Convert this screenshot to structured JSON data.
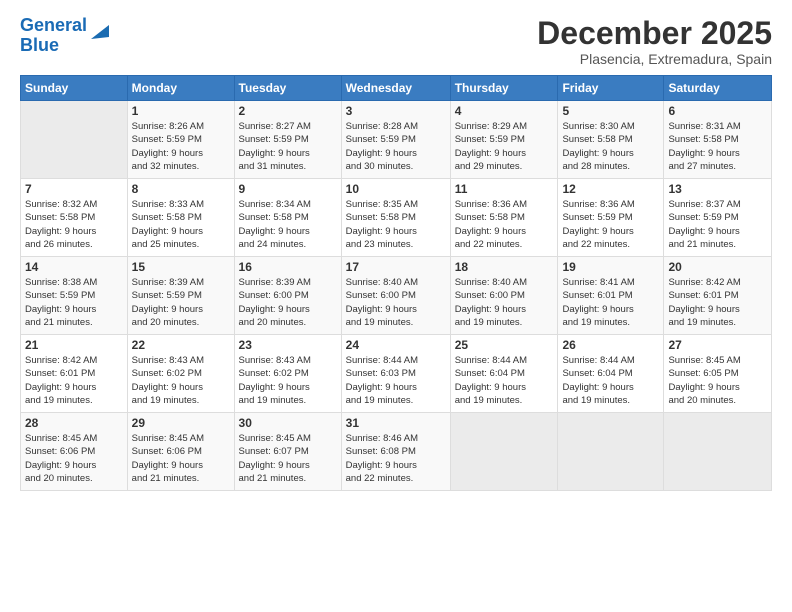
{
  "logo": {
    "line1": "General",
    "line2": "Blue"
  },
  "title": "December 2025",
  "subtitle": "Plasencia, Extremadura, Spain",
  "days_header": [
    "Sunday",
    "Monday",
    "Tuesday",
    "Wednesday",
    "Thursday",
    "Friday",
    "Saturday"
  ],
  "weeks": [
    [
      {
        "day": "",
        "info": ""
      },
      {
        "day": "1",
        "info": "Sunrise: 8:26 AM\nSunset: 5:59 PM\nDaylight: 9 hours\nand 32 minutes."
      },
      {
        "day": "2",
        "info": "Sunrise: 8:27 AM\nSunset: 5:59 PM\nDaylight: 9 hours\nand 31 minutes."
      },
      {
        "day": "3",
        "info": "Sunrise: 8:28 AM\nSunset: 5:59 PM\nDaylight: 9 hours\nand 30 minutes."
      },
      {
        "day": "4",
        "info": "Sunrise: 8:29 AM\nSunset: 5:59 PM\nDaylight: 9 hours\nand 29 minutes."
      },
      {
        "day": "5",
        "info": "Sunrise: 8:30 AM\nSunset: 5:58 PM\nDaylight: 9 hours\nand 28 minutes."
      },
      {
        "day": "6",
        "info": "Sunrise: 8:31 AM\nSunset: 5:58 PM\nDaylight: 9 hours\nand 27 minutes."
      }
    ],
    [
      {
        "day": "7",
        "info": "Sunrise: 8:32 AM\nSunset: 5:58 PM\nDaylight: 9 hours\nand 26 minutes."
      },
      {
        "day": "8",
        "info": "Sunrise: 8:33 AM\nSunset: 5:58 PM\nDaylight: 9 hours\nand 25 minutes."
      },
      {
        "day": "9",
        "info": "Sunrise: 8:34 AM\nSunset: 5:58 PM\nDaylight: 9 hours\nand 24 minutes."
      },
      {
        "day": "10",
        "info": "Sunrise: 8:35 AM\nSunset: 5:58 PM\nDaylight: 9 hours\nand 23 minutes."
      },
      {
        "day": "11",
        "info": "Sunrise: 8:36 AM\nSunset: 5:58 PM\nDaylight: 9 hours\nand 22 minutes."
      },
      {
        "day": "12",
        "info": "Sunrise: 8:36 AM\nSunset: 5:59 PM\nDaylight: 9 hours\nand 22 minutes."
      },
      {
        "day": "13",
        "info": "Sunrise: 8:37 AM\nSunset: 5:59 PM\nDaylight: 9 hours\nand 21 minutes."
      }
    ],
    [
      {
        "day": "14",
        "info": "Sunrise: 8:38 AM\nSunset: 5:59 PM\nDaylight: 9 hours\nand 21 minutes."
      },
      {
        "day": "15",
        "info": "Sunrise: 8:39 AM\nSunset: 5:59 PM\nDaylight: 9 hours\nand 20 minutes."
      },
      {
        "day": "16",
        "info": "Sunrise: 8:39 AM\nSunset: 6:00 PM\nDaylight: 9 hours\nand 20 minutes."
      },
      {
        "day": "17",
        "info": "Sunrise: 8:40 AM\nSunset: 6:00 PM\nDaylight: 9 hours\nand 19 minutes."
      },
      {
        "day": "18",
        "info": "Sunrise: 8:40 AM\nSunset: 6:00 PM\nDaylight: 9 hours\nand 19 minutes."
      },
      {
        "day": "19",
        "info": "Sunrise: 8:41 AM\nSunset: 6:01 PM\nDaylight: 9 hours\nand 19 minutes."
      },
      {
        "day": "20",
        "info": "Sunrise: 8:42 AM\nSunset: 6:01 PM\nDaylight: 9 hours\nand 19 minutes."
      }
    ],
    [
      {
        "day": "21",
        "info": "Sunrise: 8:42 AM\nSunset: 6:01 PM\nDaylight: 9 hours\nand 19 minutes."
      },
      {
        "day": "22",
        "info": "Sunrise: 8:43 AM\nSunset: 6:02 PM\nDaylight: 9 hours\nand 19 minutes."
      },
      {
        "day": "23",
        "info": "Sunrise: 8:43 AM\nSunset: 6:02 PM\nDaylight: 9 hours\nand 19 minutes."
      },
      {
        "day": "24",
        "info": "Sunrise: 8:44 AM\nSunset: 6:03 PM\nDaylight: 9 hours\nand 19 minutes."
      },
      {
        "day": "25",
        "info": "Sunrise: 8:44 AM\nSunset: 6:04 PM\nDaylight: 9 hours\nand 19 minutes."
      },
      {
        "day": "26",
        "info": "Sunrise: 8:44 AM\nSunset: 6:04 PM\nDaylight: 9 hours\nand 19 minutes."
      },
      {
        "day": "27",
        "info": "Sunrise: 8:45 AM\nSunset: 6:05 PM\nDaylight: 9 hours\nand 20 minutes."
      }
    ],
    [
      {
        "day": "28",
        "info": "Sunrise: 8:45 AM\nSunset: 6:06 PM\nDaylight: 9 hours\nand 20 minutes."
      },
      {
        "day": "29",
        "info": "Sunrise: 8:45 AM\nSunset: 6:06 PM\nDaylight: 9 hours\nand 21 minutes."
      },
      {
        "day": "30",
        "info": "Sunrise: 8:45 AM\nSunset: 6:07 PM\nDaylight: 9 hours\nand 21 minutes."
      },
      {
        "day": "31",
        "info": "Sunrise: 8:46 AM\nSunset: 6:08 PM\nDaylight: 9 hours\nand 22 minutes."
      },
      {
        "day": "",
        "info": ""
      },
      {
        "day": "",
        "info": ""
      },
      {
        "day": "",
        "info": ""
      }
    ]
  ]
}
